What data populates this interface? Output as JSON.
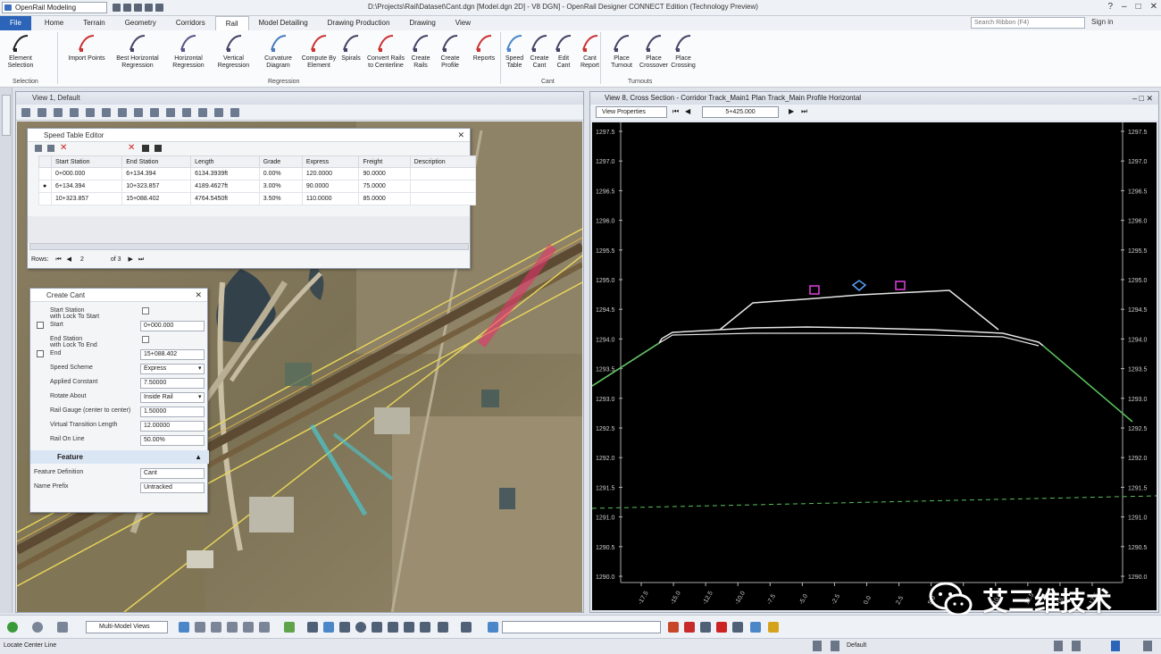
{
  "titlebar": {
    "workspace": "OpenRail Modeling",
    "document": "D:\\Projects\\Rail\\Dataset\\Cant.dgn [Model.dgn 2D] - V8 DGN] - OpenRail Designer CONNECT Edition (Technology Preview)"
  },
  "tabs": [
    "File",
    "Home",
    "Terrain",
    "Geometry",
    "Corridors",
    "Rail",
    "Model Detailing",
    "Drawing Production",
    "Drawing",
    "View"
  ],
  "search": {
    "placeholder": "Search Ribbon (F4)"
  },
  "signin": "Sign in",
  "ribbon": {
    "buttons": [
      "Element Selection",
      "Import Points",
      "Best Horizontal Regression",
      "Horizontal Regression",
      "Vertical Regression",
      "Curvature Diagram",
      "Compute By Element",
      "Spirals",
      "Convert Rails to Centerline",
      "Create Rails",
      "Create Profile",
      "Reports",
      "Speed Table",
      "Create Cant",
      "Edit Cant",
      "Cant Report",
      "Place Turnout",
      "Place Crossover",
      "Place Crossing"
    ],
    "groups": [
      "Selection",
      "Regression",
      "Cant",
      "Turnouts"
    ]
  },
  "view1": {
    "title": "View 1, Default"
  },
  "speed_table": {
    "title": "Speed Table Editor",
    "columns": [
      "Start Station",
      "End Station",
      "Length",
      "Grade",
      "Express",
      "Freight",
      "Description"
    ],
    "rows": [
      [
        "0+000.000",
        "6+134.394",
        "6134.3939ft",
        "0.00%",
        "120.0000",
        "90.0000",
        ""
      ],
      [
        "6+134.394",
        "10+323.857",
        "4189.4627ft",
        "3.00%",
        "90.0000",
        "75.0000",
        ""
      ],
      [
        "10+323.857",
        "15+088.402",
        "4764.5450ft",
        "3.50%",
        "110.0000",
        "85.0000",
        ""
      ]
    ],
    "footer": {
      "rows_label": "Rows:",
      "page": "2",
      "of": "of 3"
    }
  },
  "create_cant": {
    "title": "Create Cant",
    "fields": [
      {
        "label": "Start Station",
        "sub": "with Lock To Start",
        "type": "check"
      },
      {
        "label": "Start",
        "value": "0+000.000",
        "type": "text",
        "lock": true
      },
      {
        "label": "End Station",
        "sub": "with Lock To End",
        "type": "check"
      },
      {
        "label": "End",
        "value": "15+088.402",
        "type": "text",
        "lock": true
      },
      {
        "label": "Speed Scheme",
        "value": "Express",
        "type": "select"
      },
      {
        "label": "Applied Constant",
        "value": "7.50000",
        "type": "text"
      },
      {
        "label": "Rotate About",
        "value": "Inside Rail",
        "type": "select"
      },
      {
        "label": "Rail Gauge (center to center)",
        "value": "1.50000",
        "type": "text"
      },
      {
        "label": "Virtual Transition Length",
        "value": "12.00000",
        "type": "text"
      },
      {
        "label": "Rail On Line",
        "value": "50.00%",
        "type": "text"
      }
    ],
    "section": "Feature",
    "feature_fields": [
      {
        "label": "Feature Definition",
        "value": "Cant",
        "type": "select"
      },
      {
        "label": "Name Prefix",
        "value": "Untracked",
        "type": "text"
      }
    ]
  },
  "view2": {
    "title": "View 8, Cross Section - Corridor Track_Main1 Plan Track_Main Profile Horizontal",
    "view_props": "View Properties",
    "station": "5+425.000"
  },
  "xsection": {
    "y_ticks": [
      "1297.5",
      "1297.0",
      "1296.5",
      "1296.0",
      "1295.5",
      "1295.0",
      "1294.5",
      "1294.0",
      "1293.5",
      "1293.0",
      "1292.5",
      "1292.0",
      "1291.5",
      "1291.0",
      "1290.5",
      "1290.0"
    ],
    "x_ticks": [
      "-17.5",
      "-15.0",
      "-12.5",
      "-10.0",
      "-7.5",
      "-5.0",
      "-2.5",
      "0.0",
      "2.5",
      "5.0",
      "7.5",
      "10.0",
      "12.5",
      "15.0",
      "17.5"
    ]
  },
  "statusbar": {
    "view_mode": "Multi-Model Views",
    "level": "Default",
    "prompt": "Locate Center Line",
    "design": "Default"
  },
  "watermark": "艾三维技术"
}
